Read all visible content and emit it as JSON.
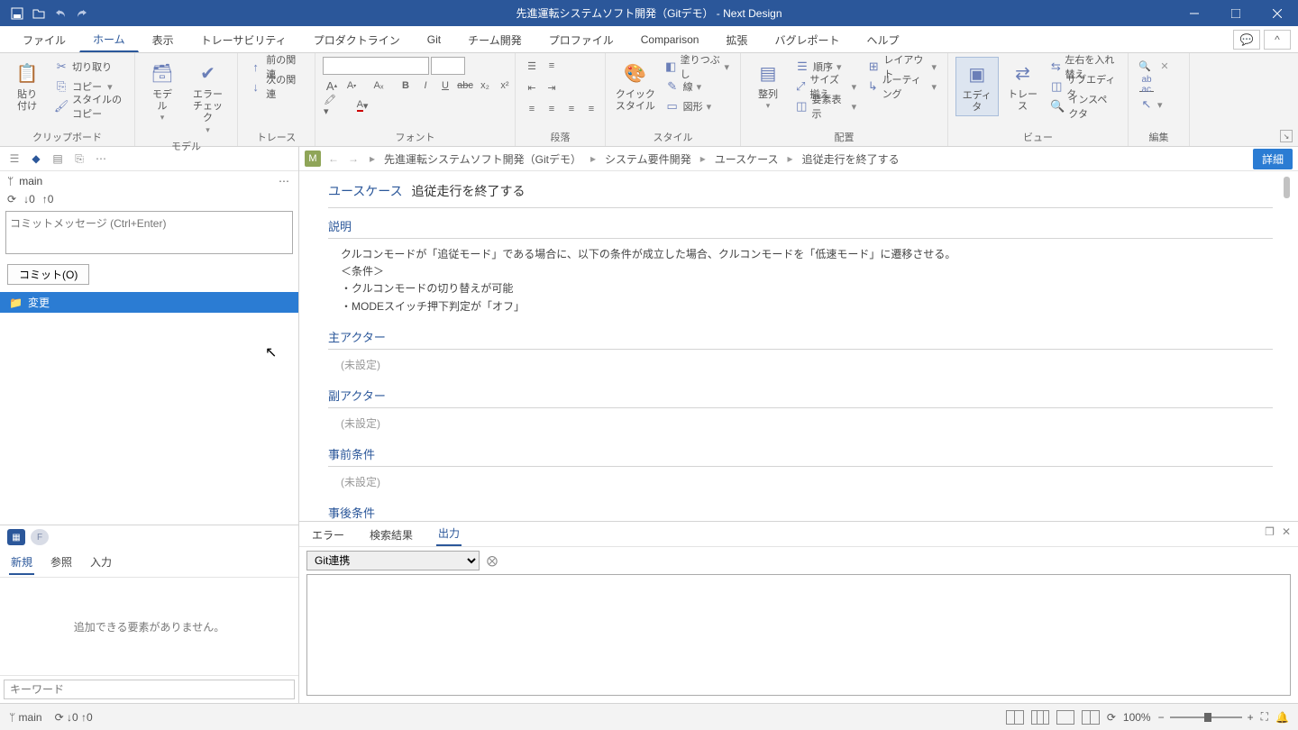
{
  "window": {
    "title": "先進運転システムソフト開発（Gitデモ） - Next Design"
  },
  "ribbon_tabs": {
    "file": "ファイル",
    "home": "ホーム",
    "display": "表示",
    "traceability": "トレーサビリティ",
    "product_line": "プロダクトライン",
    "git": "Git",
    "team": "チーム開発",
    "profile": "プロファイル",
    "comparison": "Comparison",
    "extension": "拡張",
    "bug_report": "バグレポート",
    "help": "ヘルプ"
  },
  "ribbon": {
    "clipboard": {
      "paste": "貼り付け",
      "cut": "切り取り",
      "copy": "コピー",
      "style_copy": "スタイルのコピー",
      "group": "クリップボード"
    },
    "model": {
      "model": "モデル",
      "error_check": "エラーチェック",
      "group": "モデル"
    },
    "trace": {
      "prev": "前の関連",
      "next": "次の関連",
      "group": "トレース"
    },
    "font": {
      "group": "フォント"
    },
    "paragraph": {
      "group": "段落"
    },
    "style": {
      "quick": "クイック\nスタイル",
      "fill": "塗りつぶし",
      "line": "線",
      "shape": "図形",
      "group": "スタイル"
    },
    "align": {
      "align": "整列",
      "order": "順序",
      "size": "サイズ揃え",
      "element": "要素表示",
      "layout": "レイアウト",
      "routing": "ルーティング",
      "group": "配置"
    },
    "view": {
      "editor": "エディタ",
      "trace": "トレース",
      "swap": "左右を入れ替え",
      "subeditor": "サブエディタ",
      "inspector": "インスペクタ",
      "group": "ビュー"
    },
    "edit": {
      "group": "編集"
    }
  },
  "git": {
    "branch": "main",
    "down": "0",
    "up": "0",
    "commit_placeholder": "コミットメッセージ (Ctrl+Enter)",
    "commit_btn": "コミット(O)",
    "changes": "変更"
  },
  "lp_bottom": {
    "tab_new": "新規",
    "tab_ref": "参照",
    "tab_input": "入力",
    "empty": "追加できる要素がありません。",
    "search_placeholder": "キーワード"
  },
  "breadcrumb": {
    "p0": "先進運転システムソフト開発（Gitデモ）",
    "p1": "システム要件開発",
    "p2": "ユースケース",
    "p3": "追従走行を終了する",
    "detail": "詳細"
  },
  "editor": {
    "tag": "ユースケース",
    "name": "追従走行を終了する",
    "desc_title": "説明",
    "desc_body": "クルコンモードが「追従モード」である場合に、以下の条件が成立した場合、クルコンモードを「低速モード」に遷移させる。\n＜条件＞\n・クルコンモードの切り替えが可能\n・MODEスイッチ押下判定が「オフ」",
    "main_actor": "主アクター",
    "sub_actor": "副アクター",
    "precond": "事前条件",
    "postcond": "事後条件",
    "unset": "(未設定)"
  },
  "output": {
    "tab_error": "エラー",
    "tab_search": "検索結果",
    "tab_output": "出力",
    "source": "Git連携"
  },
  "status": {
    "branch": "main",
    "down": "0",
    "up": "0",
    "zoom": "100%"
  }
}
